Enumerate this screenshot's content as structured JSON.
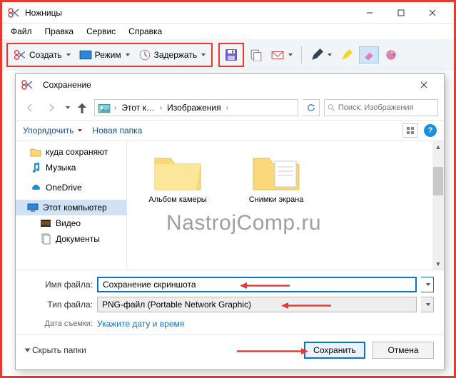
{
  "mainWindow": {
    "title": "Ножницы",
    "menu": [
      "Файл",
      "Правка",
      "Сервис",
      "Справка"
    ],
    "toolbar": {
      "create": "Создать",
      "mode": "Режим",
      "delay": "Задержать"
    }
  },
  "dialog": {
    "title": "Сохранение",
    "breadcrumb": {
      "seg1": "Этот к…",
      "seg2": "Изображения"
    },
    "searchPlaceholder": "Поиск: Изображения",
    "commands": {
      "organize": "Упорядочить",
      "newFolder": "Новая папка"
    },
    "tree": [
      {
        "label": "куда сохраняют",
        "icon": "folder"
      },
      {
        "label": "Музыка",
        "icon": "music"
      },
      {
        "label": "OneDrive",
        "icon": "onedrive"
      },
      {
        "label": "Этот компьютер",
        "icon": "pc"
      },
      {
        "label": "Видео",
        "icon": "video"
      },
      {
        "label": "Документы",
        "icon": "docs"
      }
    ],
    "contentFolders": [
      {
        "label": "Альбом камеры"
      },
      {
        "label": "Снимки экрана"
      }
    ],
    "fields": {
      "nameLabel": "Имя файла:",
      "nameValue": "Сохранение скриншота",
      "typeLabel": "Тип файла:",
      "typeValue": "PNG-файл (Portable Network Graphic)",
      "metaLabel": "Дата съемки:",
      "metaLink": "Укажите дату и время"
    },
    "footer": {
      "hideFolders": "Скрыть папки",
      "save": "Сохранить",
      "cancel": "Отмена"
    }
  },
  "watermark": "NastrojComp.ru"
}
